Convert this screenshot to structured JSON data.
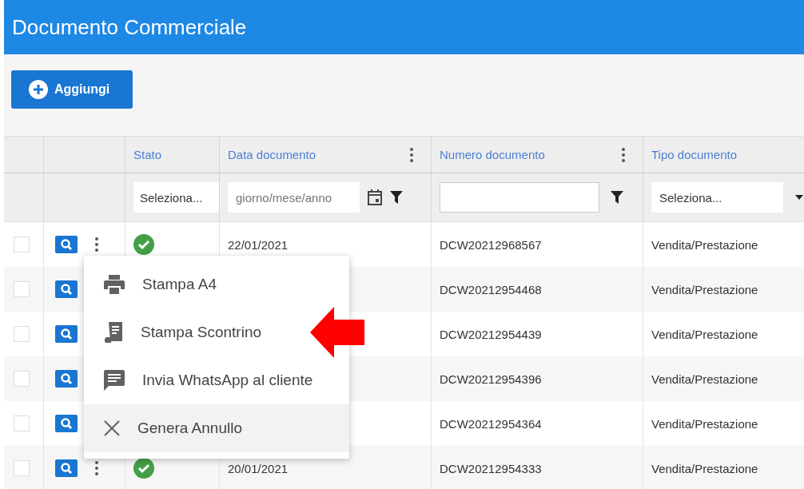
{
  "header": {
    "title": "Documento Commerciale"
  },
  "toolbar": {
    "add_button": "Aggiungi"
  },
  "table": {
    "columns": [
      "Stato",
      "Data documento",
      "Numero documento",
      "Tipo documento"
    ],
    "filters": {
      "stato": "Seleziona...",
      "data_placeholder": "giorno/mese/anno",
      "tipo": "Seleziona..."
    },
    "rows": [
      {
        "checked": false,
        "done": true,
        "date": "22/01/2021",
        "number": "DCW20212968567",
        "type": "Vendita/Prestazione"
      },
      {
        "checked": false,
        "number": "DCW20212954468",
        "type": "Vendita/Prestazione"
      },
      {
        "checked": false,
        "number": "DCW20212954439",
        "type": "Vendita/Prestazione"
      },
      {
        "checked": false,
        "number": "DCW20212954396",
        "type": "Vendita/Prestazione"
      },
      {
        "checked": false,
        "number": "DCW20212954364",
        "type": "Vendita/Prestazione"
      },
      {
        "checked": false,
        "done": true,
        "date": "20/01/2021",
        "number": "DCW20212954333",
        "type": "Vendita/Prestazione"
      }
    ]
  },
  "menu": {
    "items": [
      {
        "kind": "print",
        "label": "Stampa A4",
        "selected": false
      },
      {
        "kind": "receipt",
        "label": "Stampa Scontrino",
        "selected": false
      },
      {
        "kind": "message",
        "label": "Invia WhatsApp al cliente",
        "selected": false
      },
      {
        "kind": "cancel",
        "label": "Genera Annullo",
        "selected": true
      }
    ]
  }
}
